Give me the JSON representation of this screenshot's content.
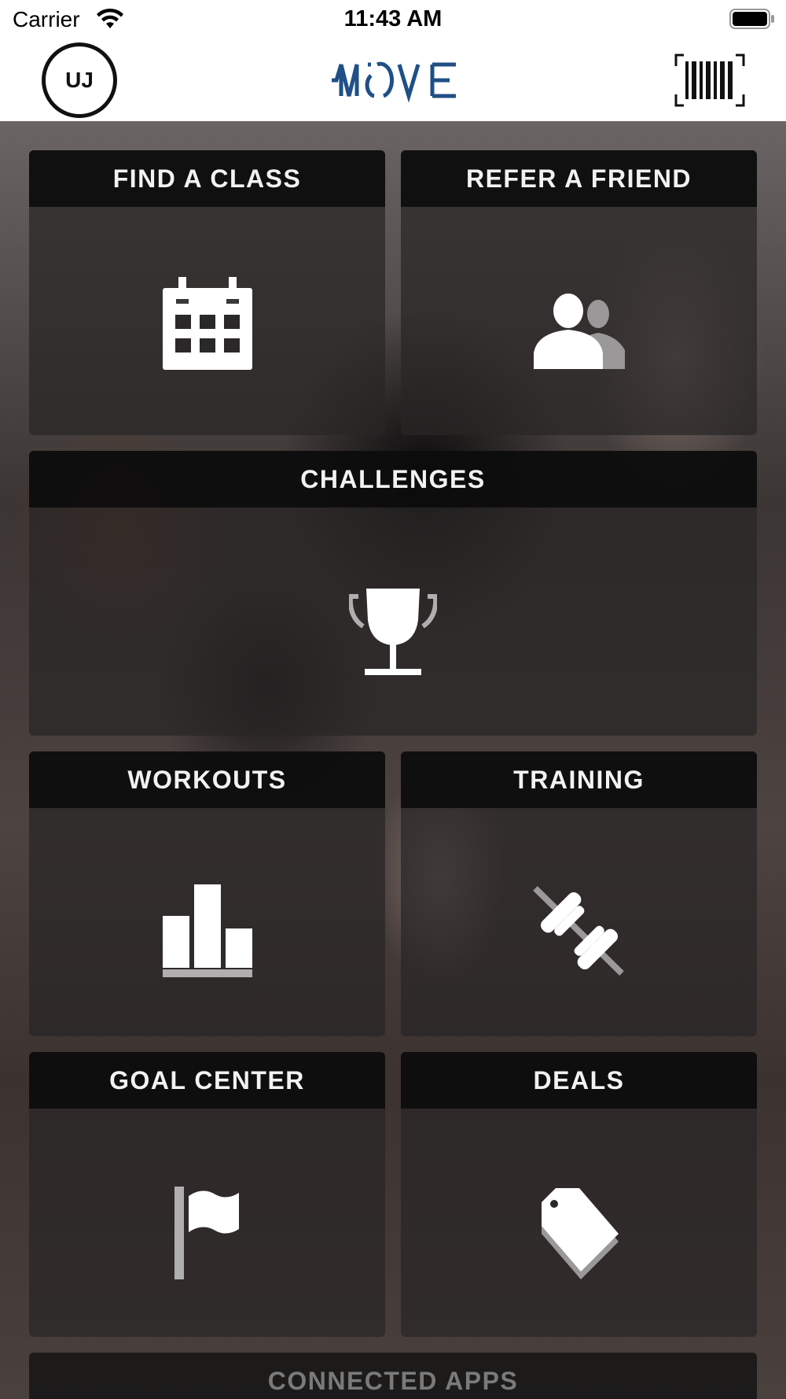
{
  "status_bar": {
    "carrier": "Carrier",
    "time": "11:43 AM"
  },
  "header": {
    "avatar_initials": "UJ",
    "logo_text": "MOVE",
    "brand_color": "#1f4f86"
  },
  "tiles": [
    {
      "label": "FIND A CLASS",
      "icon": "calendar-icon"
    },
    {
      "label": "REFER A FRIEND",
      "icon": "people-icon"
    },
    {
      "label": "CHALLENGES",
      "icon": "trophy-icon"
    },
    {
      "label": "WORKOUTS",
      "icon": "bar-chart-icon"
    },
    {
      "label": "TRAINING",
      "icon": "dumbbell-icon"
    },
    {
      "label": "GOAL CENTER",
      "icon": "flag-icon"
    },
    {
      "label": "DEALS",
      "icon": "tag-icon"
    },
    {
      "label": "CONNECTED APPS",
      "icon": ""
    }
  ]
}
